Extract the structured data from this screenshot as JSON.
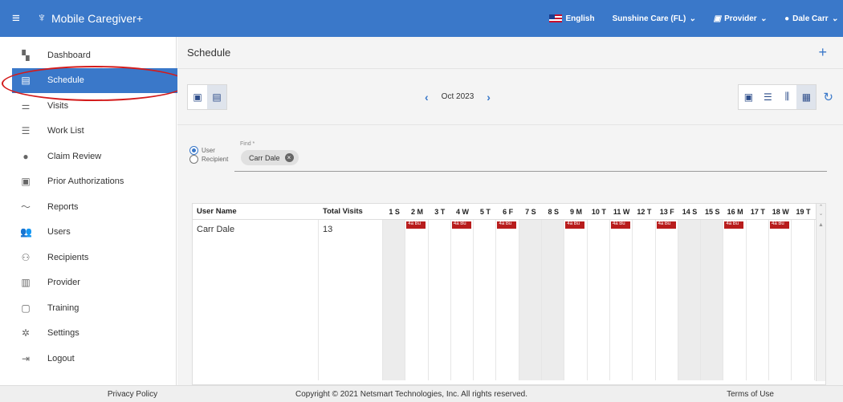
{
  "header": {
    "app_name": "Mobile Caregiver+",
    "language": "English",
    "agency": "Sunshine Care (FL)",
    "role": "Provider",
    "user": "Dale Carr"
  },
  "sidebar": {
    "items": [
      {
        "label": "Dashboard",
        "icon": "dashboard-icon"
      },
      {
        "label": "Schedule",
        "icon": "calendar-icon"
      },
      {
        "label": "Visits",
        "icon": "filter-icon"
      },
      {
        "label": "Work List",
        "icon": "list-icon"
      },
      {
        "label": "Claim Review",
        "icon": "alert-icon"
      },
      {
        "label": "Prior Authorizations",
        "icon": "calendar-small-icon"
      },
      {
        "label": "Reports",
        "icon": "chart-line-icon"
      },
      {
        "label": "Users",
        "icon": "users-icon"
      },
      {
        "label": "Recipients",
        "icon": "recipients-icon"
      },
      {
        "label": "Provider",
        "icon": "clipboard-icon"
      },
      {
        "label": "Training",
        "icon": "training-icon"
      },
      {
        "label": "Settings",
        "icon": "gear-icon"
      },
      {
        "label": "Logout",
        "icon": "logout-icon"
      }
    ],
    "active_index": 1
  },
  "main": {
    "title": "Schedule",
    "month": "Oct 2023",
    "filter": {
      "radio_user": "User",
      "radio_recipient": "Recipient",
      "find_label": "Find *",
      "chip": "Carr Dale"
    },
    "grid": {
      "col_user": "User Name",
      "col_total": "Total Visits",
      "days": [
        "1 S",
        "2 M",
        "3 T",
        "4 W",
        "5 T",
        "6 F",
        "7 S",
        "8 S",
        "9 M",
        "10 T",
        "11 W",
        "12 T",
        "13 F",
        "14 S",
        "15 S",
        "16 M",
        "17 T",
        "18 W",
        "19 T"
      ],
      "weekend_days": [
        1,
        7,
        8,
        14,
        15
      ],
      "rows": [
        {
          "user": "Carr Dale",
          "total": "13",
          "event_label": "4a Bu",
          "event_days": [
            2,
            4,
            6,
            9,
            11,
            13,
            16,
            18
          ]
        }
      ]
    }
  },
  "footer": {
    "privacy": "Privacy Policy",
    "copyright": "Copyright © 2021 Netsmart Technologies, Inc. All rights reserved.",
    "terms": "Terms of Use"
  },
  "colors": {
    "primary": "#3a78c9",
    "event": "#b81c1c",
    "annotation": "#d31b1b"
  }
}
